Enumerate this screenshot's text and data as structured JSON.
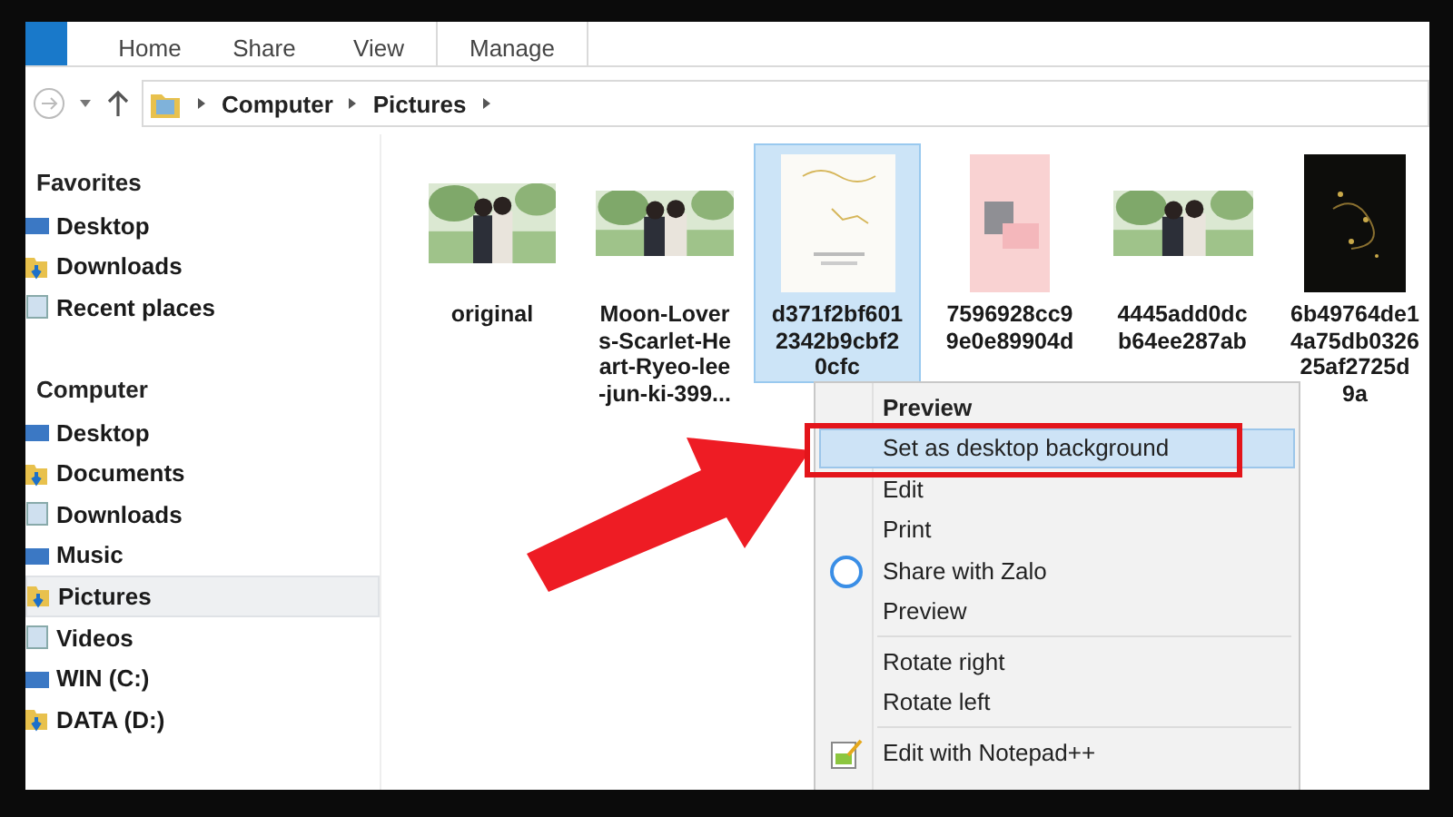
{
  "ribbon": {
    "tabs": [
      {
        "label": "Home",
        "selected": false
      },
      {
        "label": "Share",
        "selected": false
      },
      {
        "label": "View",
        "selected": false
      },
      {
        "label": "Manage",
        "selected": false
      }
    ]
  },
  "address_bar": {
    "path": [
      "Computer",
      "Pictures"
    ]
  },
  "sidebar": {
    "groups": [
      {
        "title": "Favorites",
        "items": [
          {
            "label": "Desktop",
            "selected": false
          },
          {
            "label": "Downloads",
            "selected": false
          },
          {
            "label": "Recent places",
            "selected": false
          }
        ]
      },
      {
        "title": "Computer",
        "items": [
          {
            "label": "Desktop",
            "selected": false
          },
          {
            "label": "Documents",
            "selected": false
          },
          {
            "label": "Downloads",
            "selected": false
          },
          {
            "label": "Music",
            "selected": false
          },
          {
            "label": "Pictures",
            "selected": true
          },
          {
            "label": "Videos",
            "selected": false
          },
          {
            "label": "WIN (C:)",
            "selected": false
          },
          {
            "label": "DATA (D:)",
            "selected": false
          }
        ]
      }
    ]
  },
  "files": [
    {
      "name_lines": [
        "original"
      ],
      "selected": false
    },
    {
      "name_lines": [
        "Moon-Lover",
        "s-Scarlet-He",
        "art-Ryeo-lee",
        "-jun-ki-399..."
      ],
      "selected": false
    },
    {
      "name_lines": [
        "d371f2bf601",
        "2342b9cbf2",
        "0cfc"
      ],
      "selected": true
    },
    {
      "name_lines": [
        "7596928cc9",
        "9e0e89904d"
      ],
      "selected": false
    },
    {
      "name_lines": [
        "4445add0dc",
        "b64ee287ab"
      ],
      "selected": false
    },
    {
      "name_lines": [
        "6b49764de1",
        "4a75db0326",
        "25af2725d",
        "9a"
      ],
      "selected": false
    }
  ],
  "context_menu": {
    "items": [
      {
        "kind": "item",
        "label": "Preview",
        "default": true,
        "selected": false
      },
      {
        "kind": "item",
        "label": "Set as desktop background",
        "default": false,
        "selected": true
      },
      {
        "kind": "item",
        "label": "Edit",
        "default": false,
        "selected": false
      },
      {
        "kind": "item",
        "label": "Print",
        "default": false,
        "selected": false
      },
      {
        "kind": "share-item",
        "label": "Share with Zalo",
        "default": false,
        "selected": false
      },
      {
        "kind": "item",
        "label": "Preview",
        "default": false,
        "selected": false
      },
      {
        "kind": "separator"
      },
      {
        "kind": "item",
        "label": "Rotate right",
        "default": false,
        "selected": false
      },
      {
        "kind": "item",
        "label": "Rotate left",
        "default": false,
        "selected": false
      },
      {
        "kind": "separator"
      },
      {
        "kind": "editor-item",
        "label": "Edit with Notepad++",
        "default": false,
        "selected": false
      }
    ]
  }
}
